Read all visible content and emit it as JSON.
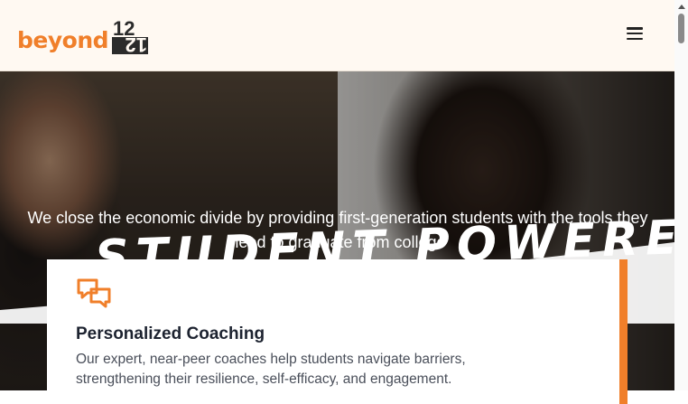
{
  "header": {
    "logo_word": "beyond",
    "logo_mark_top": "12",
    "logo_mark_bottom": "12",
    "menu_icon": "hamburger-menu-icon"
  },
  "hero": {
    "tagline": "We close the economic divide by providing first-generation students with the tools they need to graduate from college",
    "brush_word": "Student Powered"
  },
  "card": {
    "icon": "chat-bubbles-icon",
    "title": "Personalized Coaching",
    "body": "Our expert, near-peer coaches help students navigate barriers, strengthening their resilience, self-efficacy, and engagement."
  },
  "colors": {
    "brand_orange": "#f07f2a",
    "header_bg": "#fff9f2",
    "title_text": "#1d2330"
  }
}
